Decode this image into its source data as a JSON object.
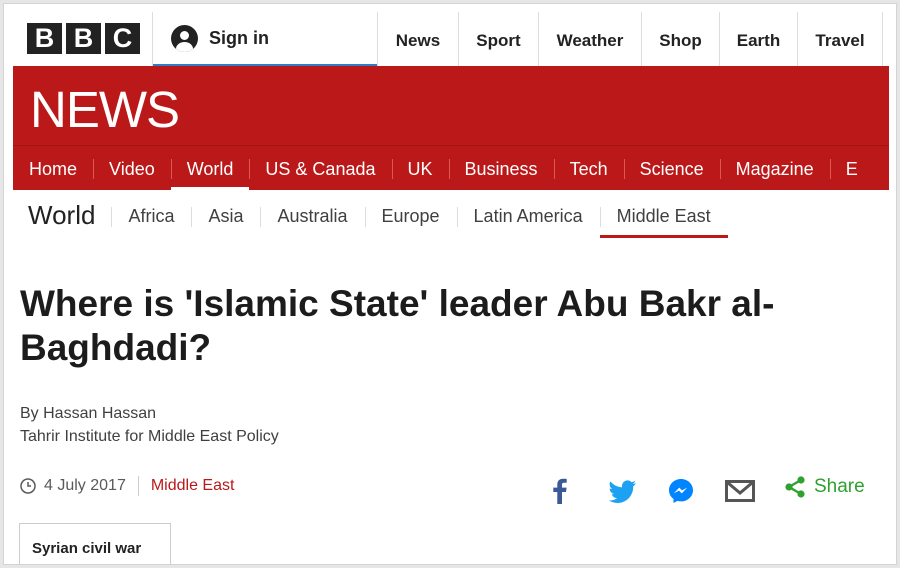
{
  "masthead": {
    "logo_letters": [
      "B",
      "B",
      "C"
    ],
    "signin_label": "Sign in",
    "nav": [
      "News",
      "Sport",
      "Weather",
      "Shop",
      "Earth",
      "Travel"
    ]
  },
  "news_band": {
    "title": "NEWS",
    "nav": [
      {
        "label": "Home",
        "active": false
      },
      {
        "label": "Video",
        "active": false
      },
      {
        "label": "World",
        "active": true
      },
      {
        "label": "US & Canada",
        "active": false
      },
      {
        "label": "UK",
        "active": false
      },
      {
        "label": "Business",
        "active": false
      },
      {
        "label": "Tech",
        "active": false
      },
      {
        "label": "Science",
        "active": false
      },
      {
        "label": "Magazine",
        "active": false
      },
      {
        "label": "E",
        "active": false
      }
    ]
  },
  "world_nav": {
    "title": "World",
    "items": [
      {
        "label": "Africa",
        "active": false
      },
      {
        "label": "Asia",
        "active": false
      },
      {
        "label": "Australia",
        "active": false
      },
      {
        "label": "Europe",
        "active": false
      },
      {
        "label": "Latin America",
        "active": false
      },
      {
        "label": "Middle East",
        "active": true
      }
    ]
  },
  "article": {
    "headline": "Where is 'Islamic State' leader Abu Bakr al-Baghdadi?",
    "author": "By Hassan Hassan",
    "affiliation": "Tahrir Institute for Middle East Policy",
    "date": "4 July 2017",
    "section": "Middle East",
    "tag": "Syrian civil war"
  },
  "social": {
    "icons": [
      "facebook-icon",
      "twitter-icon",
      "messenger-icon",
      "email-icon"
    ],
    "share_label": "Share"
  },
  "colors": {
    "bbc_red": "#bb1919",
    "facebook": "#3b5998",
    "twitter": "#1da1f2",
    "messenger": "#0084ff",
    "share_green": "#2fa12f",
    "signin_accent": "#2f7fc8"
  }
}
